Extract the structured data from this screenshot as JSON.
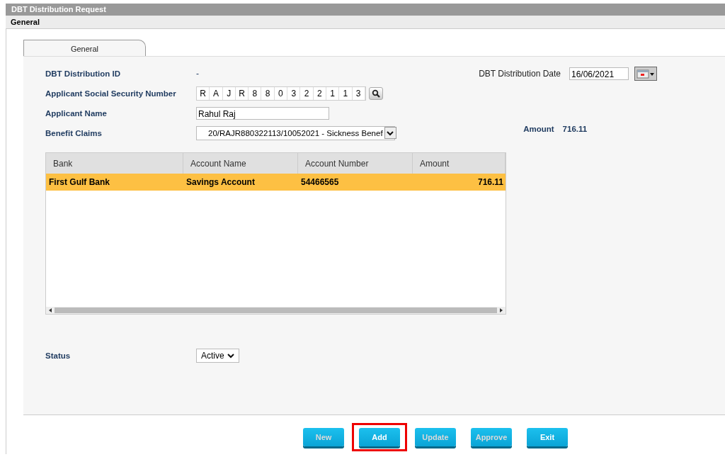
{
  "window": {
    "title": "DBT Distribution Request"
  },
  "section_header": "General",
  "tabs": [
    {
      "label": "General",
      "selected": true
    }
  ],
  "form": {
    "id_label": "DBT Distribution ID",
    "id_value": "-",
    "date_label": "DBT Distribution Date",
    "date_value": "16/06/2021",
    "ssn_label": "Applicant Social Security Number",
    "ssn_chars": [
      "R",
      "A",
      "J",
      "R",
      "8",
      "8",
      "0",
      "3",
      "2",
      "2",
      "1",
      "1",
      "3"
    ],
    "name_label": "Applicant Name",
    "name_value": "Rahul Raj",
    "claims_label": "Benefit Claims",
    "claims_value": "20/RAJR880322113/10052021 - Sickness Benef",
    "amount_label": "Amount",
    "amount_value": "716.11",
    "status_label": "Status",
    "status_value": "Active"
  },
  "table": {
    "columns": [
      "Bank",
      "Account Name",
      "Account Number",
      "Amount"
    ],
    "rows": [
      {
        "cells": [
          "First Gulf Bank",
          "Savings Account",
          "54466565",
          "716.11"
        ],
        "selected": true
      }
    ]
  },
  "buttons": [
    {
      "label": "New",
      "disabled": true,
      "highlighted": false
    },
    {
      "label": "Add",
      "disabled": false,
      "highlighted": true
    },
    {
      "label": "Update",
      "disabled": true,
      "highlighted": false
    },
    {
      "label": "Approve",
      "disabled": true,
      "highlighted": false
    },
    {
      "label": "Exit",
      "disabled": false,
      "highlighted": false
    }
  ]
}
